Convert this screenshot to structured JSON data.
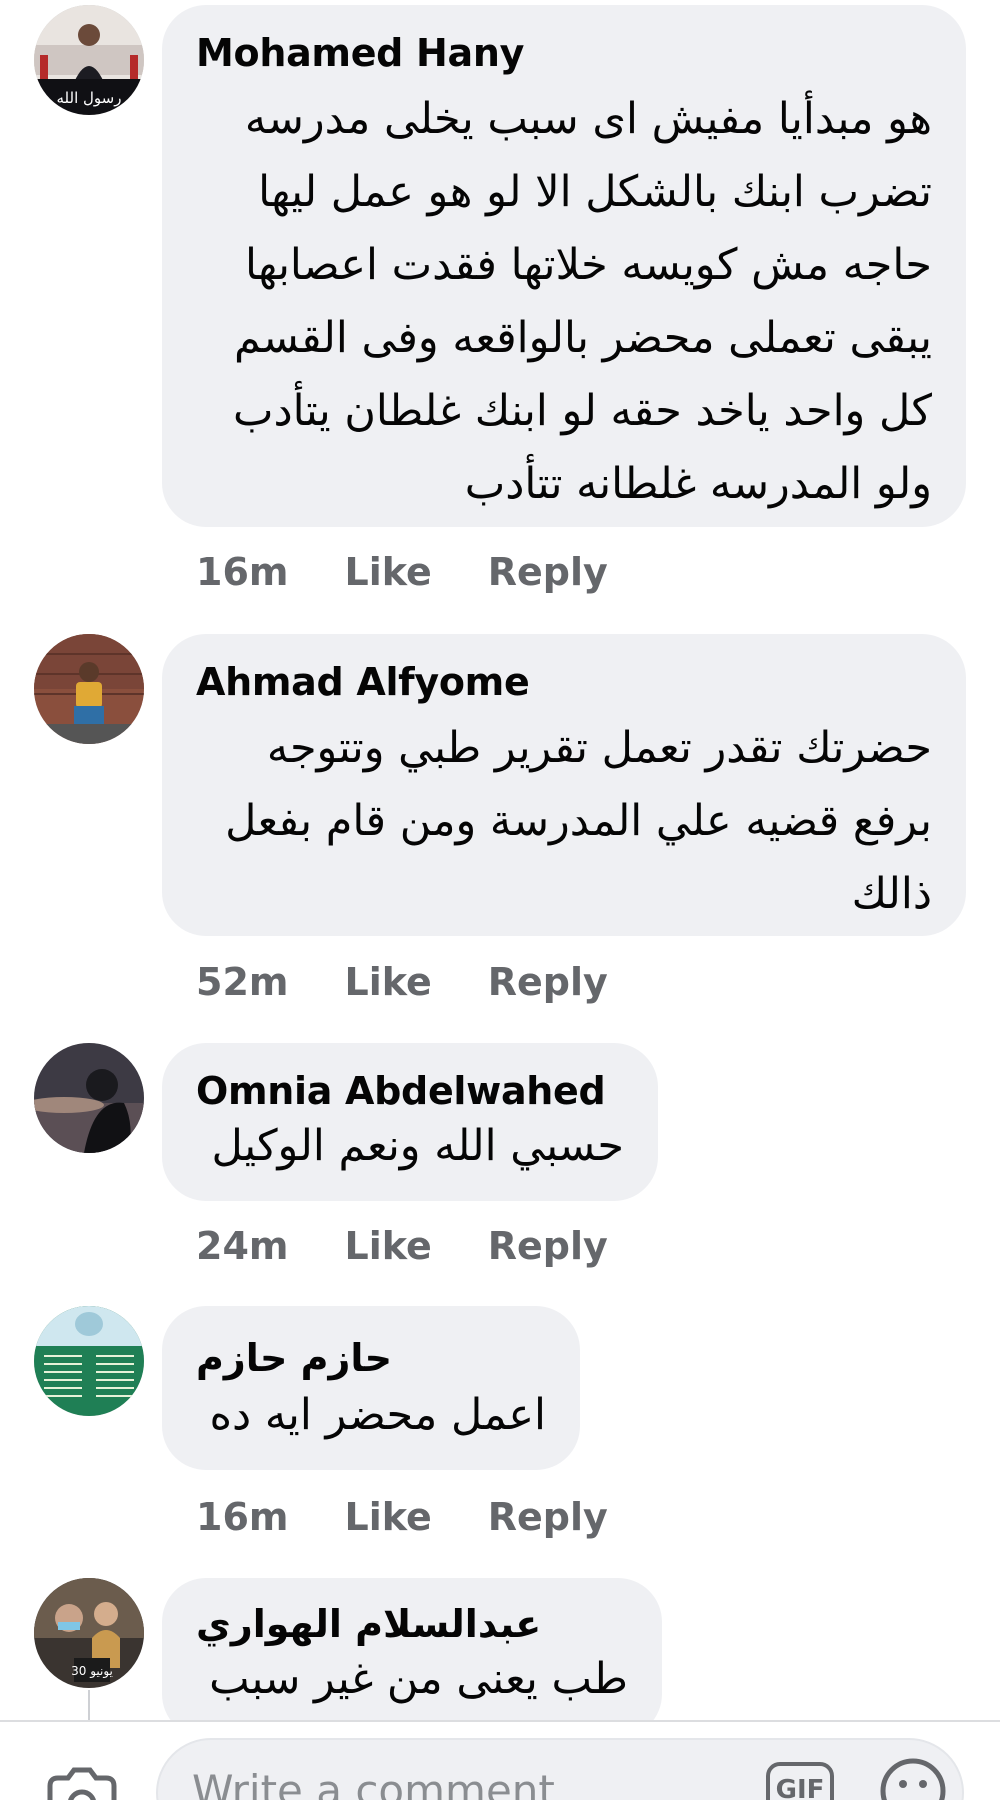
{
  "comments": [
    {
      "author": "Mohamed Hany",
      "lines": [
        "هو مبدأيا مفيش اى سبب يخلى مدرسه",
        "تضرب ابنك بالشكل الا لو هو عمل ليها",
        "حاجه مش كويسه خلاتها فقدت اعصابها",
        "يبقى تعملى محضر بالواقعه وفى القسم",
        "كل واحد ياخد حقه لو ابنك غلطان يتأدب",
        "ولو المدرسه غلطانه تتأدب"
      ],
      "time": "16m",
      "like": "Like",
      "reply": "Reply",
      "avatar_overlay_text": "رسول الله"
    },
    {
      "author": "Ahmad Alfyome",
      "lines": [
        "حضرتك تقدر تعمل تقرير طبي وتتوجه",
        "برفع قضيه علي المدرسة ومن قام بفعل",
        "ذالك"
      ],
      "time": "52m",
      "like": "Like",
      "reply": "Reply"
    },
    {
      "author": "Omnia Abdelwahed",
      "lines": [
        "حسبي الله ونعم الوكيل"
      ],
      "time": "24m",
      "like": "Like",
      "reply": "Reply"
    },
    {
      "author": "حازم حازم",
      "lines": [
        "اعمل محضر ايه ده"
      ],
      "time": "16m",
      "like": "Like",
      "reply": "Reply"
    },
    {
      "author": "عبدالسلام الهواري",
      "lines": [
        "طب يعنى من غير سبب"
      ],
      "avatar_overlay_text": "30 يونيو"
    }
  ],
  "composer": {
    "placeholder": "Write a comment",
    "gif_label": "GIF",
    "icons": [
      "camera-icon",
      "gif-icon",
      "emoji-icon"
    ]
  },
  "colors": {
    "bubble": "#eff0f3",
    "meta": "#65676b",
    "text": "#050505"
  }
}
